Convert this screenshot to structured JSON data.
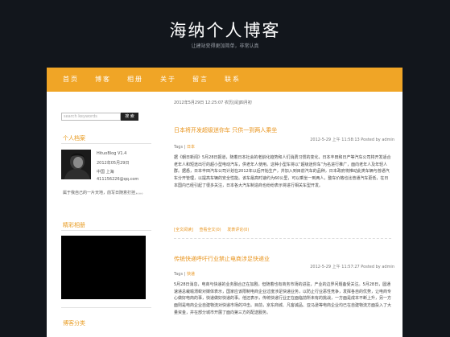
{
  "site": {
    "title": "海纳个人博客",
    "tagline": "让建站变得更加简单，非常认真"
  },
  "nav": {
    "items": [
      "首页",
      "博客",
      "相册",
      "关于",
      "留言",
      "联系"
    ],
    "accent_color": "#f0a526"
  },
  "sidebar": {
    "search": {
      "placeholder": "search keywords",
      "button_label": "搜 索"
    },
    "profile": {
      "title": "个人档案",
      "lines": [
        "HituoBlog V1.4",
        "2012年05月29日",
        "中国 上海",
        "411156226@qq.com"
      ],
      "note": "属于我自己的一片天地，前写日随意打挂，。。。",
      "avatar_icon": "profile-photo"
    },
    "video": {
      "title": "精彩相册"
    },
    "categories": {
      "title": "博客分类"
    }
  },
  "content": {
    "date_line": "2012年5月29日 12:25:07 农历[闰]四月初",
    "posts": [
      {
        "title": "日本将开发超级迷你车 只供一到两人乘坐",
        "meta": "2012-5-29 上午 11:58:13  Posted by admin",
        "tags_label": "Tags |",
        "tag": "日本",
        "body": "据《朝日新闻》5月28日报道，随着日本社会的老龄化趋势和人们消费习惯的变化，日本丰田和日产等汽车公司将开发适合老年人和短途出行的超小型电动汽车，供老年人使用。这种小型车将以“超级迷你车”为名进行推广，面向老年人及年轻人群。据悉，日本丰田汽车公司计划在2012年以后开始生产，并加入到目前汽车的品种，日本政府将推动此类车辆与普通汽车分开管理，以提高车辆的安全性能。该车最高时速约为60公里，可以乘坐一到两人，整车价格也比普通汽车更低，在日本国内已经引起了很多关注，日本各大汽车制造商也纷纷表示将进行相关车型开发。",
        "links": [
          "[全文阅读]",
          "查看全文(0)",
          "发表评论(0)"
        ]
      },
      {
        "title": "传统快递呼吁行业禁止电商涉足快递业",
        "meta": "2012-5-29 上午 11:57:27  Posted by admin",
        "tags_label": "Tags |",
        "tag": "快递",
        "body": "5月28日消息，电商与快递的业务融合正在加剧。但随着也有商务市场的进驻，产业的边界问题备受关注。5月28日，圆通速递总裁喻渭蛟对媒体表示，国家应该限制电商企业过度涉足快递业务，以防止行业恶性竞争，发挥各自的优势，让电商专心做好电商的事，快递做好快递的事。他还表示，传统快递行业正在面临前所未有的挑战，一方面是成本不断上升，另一方面则是电商企业自建物流对快递市场的冲击。目前，京东商城、凡客诚品、亚马逊等电商企业均已在自建物流方面投入了大量资金，并在部分城市开展了面向第三方的配送服务。"
      }
    ]
  }
}
